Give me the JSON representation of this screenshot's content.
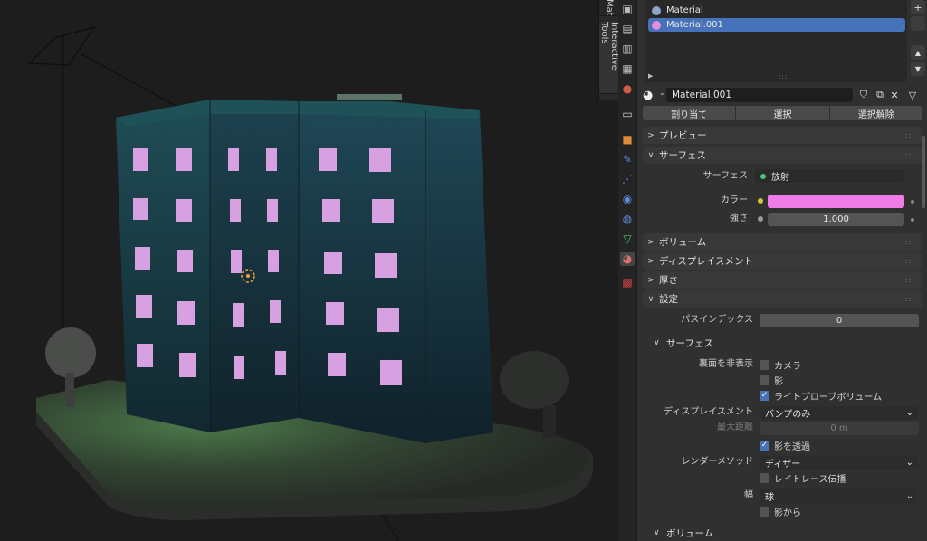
{
  "viewport": {
    "sidebar_tabs": {
      "item": "Mat",
      "tools": "Interactive Tools"
    }
  },
  "properties_tabs": [
    "tool-icon",
    "render-icon",
    "output-icon",
    "view-layer-icon",
    "scene-icon",
    "world-icon",
    "object-icon",
    "modifier-icon",
    "particles-icon",
    "physics-icon",
    "constraints-icon",
    "data-icon",
    "material-icon",
    "texture-icon"
  ],
  "material_slots": {
    "items": [
      {
        "name": "Material",
        "color": "#8ea6c9",
        "selected": false
      },
      {
        "name": "Material.001",
        "color": "#e38ee0",
        "selected": true
      }
    ],
    "add_label": "+",
    "remove_label": "−",
    "up_label": "▲",
    "down_label": "▼",
    "expand_label": "▶",
    "grip": ":::"
  },
  "material": {
    "name": "Material.001",
    "assign": "割り当て",
    "select": "選択",
    "deselect": "選択解除"
  },
  "sections": {
    "preview": "プレビュー",
    "surface": "サーフェス",
    "volume": "ボリューム",
    "displacement": "ディスプレイスメント",
    "thickness": "厚さ",
    "settings": "設定"
  },
  "surface": {
    "shader_label": "サーフェス",
    "shader_value": "放射",
    "color_label": "カラー",
    "color_value": "#f07ce8",
    "strength_label": "強さ",
    "strength_value": "1.000"
  },
  "settings": {
    "pass_index_label": "パスインデックス",
    "pass_index_value": "0",
    "surface_sub": "サーフェス",
    "backface_label": "裏面を非表示",
    "camera": "カメラ",
    "shadow": "影",
    "light_probe": "ライトプローブボリューム",
    "displacement_label": "ディスプレイスメント",
    "displacement_value": "バンプのみ",
    "max_distance_label": "最大距離",
    "max_distance_value": "0 m",
    "transparent_shadow": "影を透過",
    "render_method_label": "レンダーメソッド",
    "render_method_value": "ディザー",
    "raytrace": "レイトレース伝播",
    "width_label": "幅",
    "width_value": "球",
    "from_shadow": "影から",
    "volume_sub": "ボリューム"
  }
}
